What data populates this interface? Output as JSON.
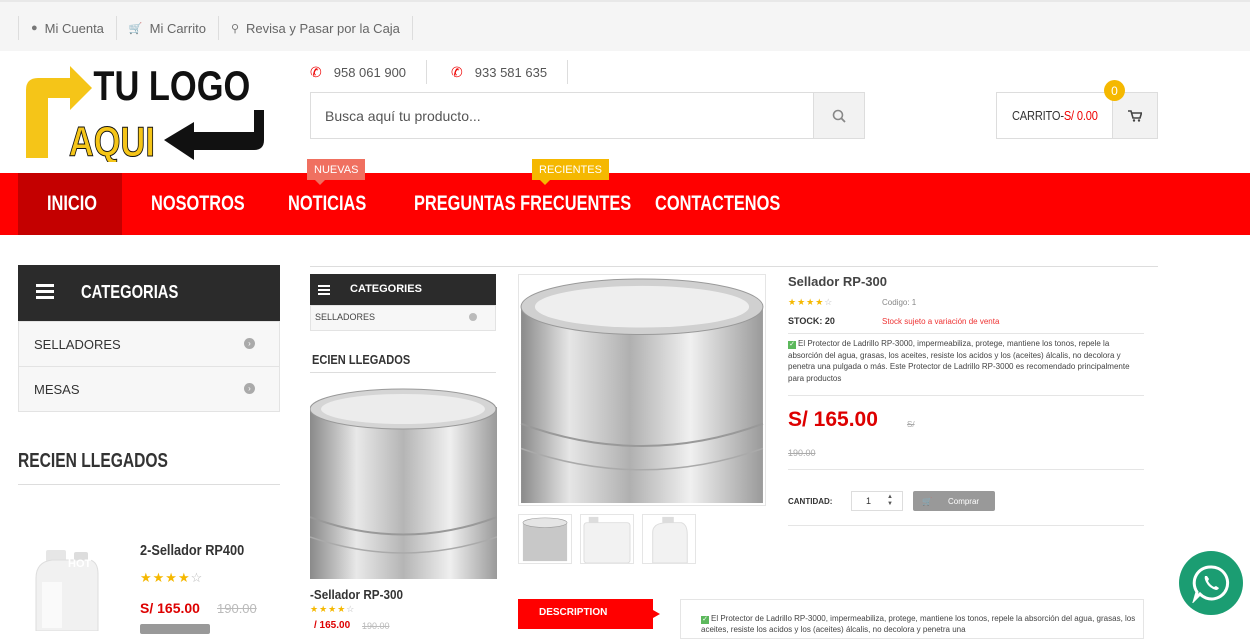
{
  "topbar": {
    "links": [
      {
        "icon": "user-icon",
        "label": "Mi Cuenta"
      },
      {
        "icon": "cart-icon",
        "label": "Mi Carrito"
      },
      {
        "icon": "key-icon",
        "label": "Revisa y Pasar por la Caja"
      }
    ]
  },
  "logo": {
    "line1": "TU LOGO",
    "line2": "AQUI"
  },
  "phones": [
    "958 061 900",
    "933 581 635"
  ],
  "search": {
    "placeholder": "Busca aquí tu producto..."
  },
  "cart": {
    "label": "CARRITO-",
    "amount": "S/ 0.00",
    "count": "0"
  },
  "nav": {
    "items": [
      "INICIO",
      "NOSOTROS",
      "NOTICIAS",
      "PREGUNTAS FRECUENTES",
      "CONTACTENOS"
    ],
    "tags": {
      "noticias": "NUEVAS",
      "preguntas": "RECIENTES"
    }
  },
  "sidebar": {
    "categories_title": "CATEGORIAS",
    "categories": [
      "SELLADORES",
      "MESAS"
    ],
    "recent_title": "RECIEN LLEGADOS",
    "product": {
      "badge": "HOT",
      "name": "2-Sellador RP400",
      "rating": 4,
      "price": "S/ 165.00",
      "old_price": "190.00"
    }
  },
  "mid": {
    "categories_title": "CATEGORIES",
    "category": "SELLADORES",
    "recent_title": "ECIEN LLEGADOS",
    "product": {
      "name": "-Sellador RP-300",
      "rating": 4,
      "price": "/ 165.00",
      "old_price": "190.00"
    }
  },
  "product": {
    "name": "Sellador RP-300",
    "rating": 4,
    "code": "Codigo: 1",
    "stock": "STOCK: 20",
    "stock_note": "Stock sujeto a variación de venta",
    "description": "El Protector de Ladrillo RP-3000, impermeabiliza, protege, mantiene los tonos, repele la absorción del agua, grasas, los aceites, resiste los acidos y los (aceites) álcalis, no decolora y penetra una pulgada o más. Este Protector de Ladrillo RP-3000 es recomendado principalmente para productos",
    "price": "S/ 165.00",
    "price_currency_struck": "S/",
    "old_price": "190.00",
    "qty_label": "CANTIDAD:",
    "qty": "1",
    "buy_label": "Comprar",
    "tab_label": "DESCRIPTION",
    "tab_text": "El Protector de Ladrillo RP-3000, impermeabiliza, protege, mantiene los tonos, repele la absorción del agua, grasas, los aceites, resiste los acidos y los (aceites) álcalis, no decolora y penetra una"
  },
  "colors": {
    "primary": "#ff0000",
    "dark": "#2b2b2b",
    "accent": "#f5b800",
    "price": "#dd0000",
    "whatsapp": "#1b9d72"
  }
}
